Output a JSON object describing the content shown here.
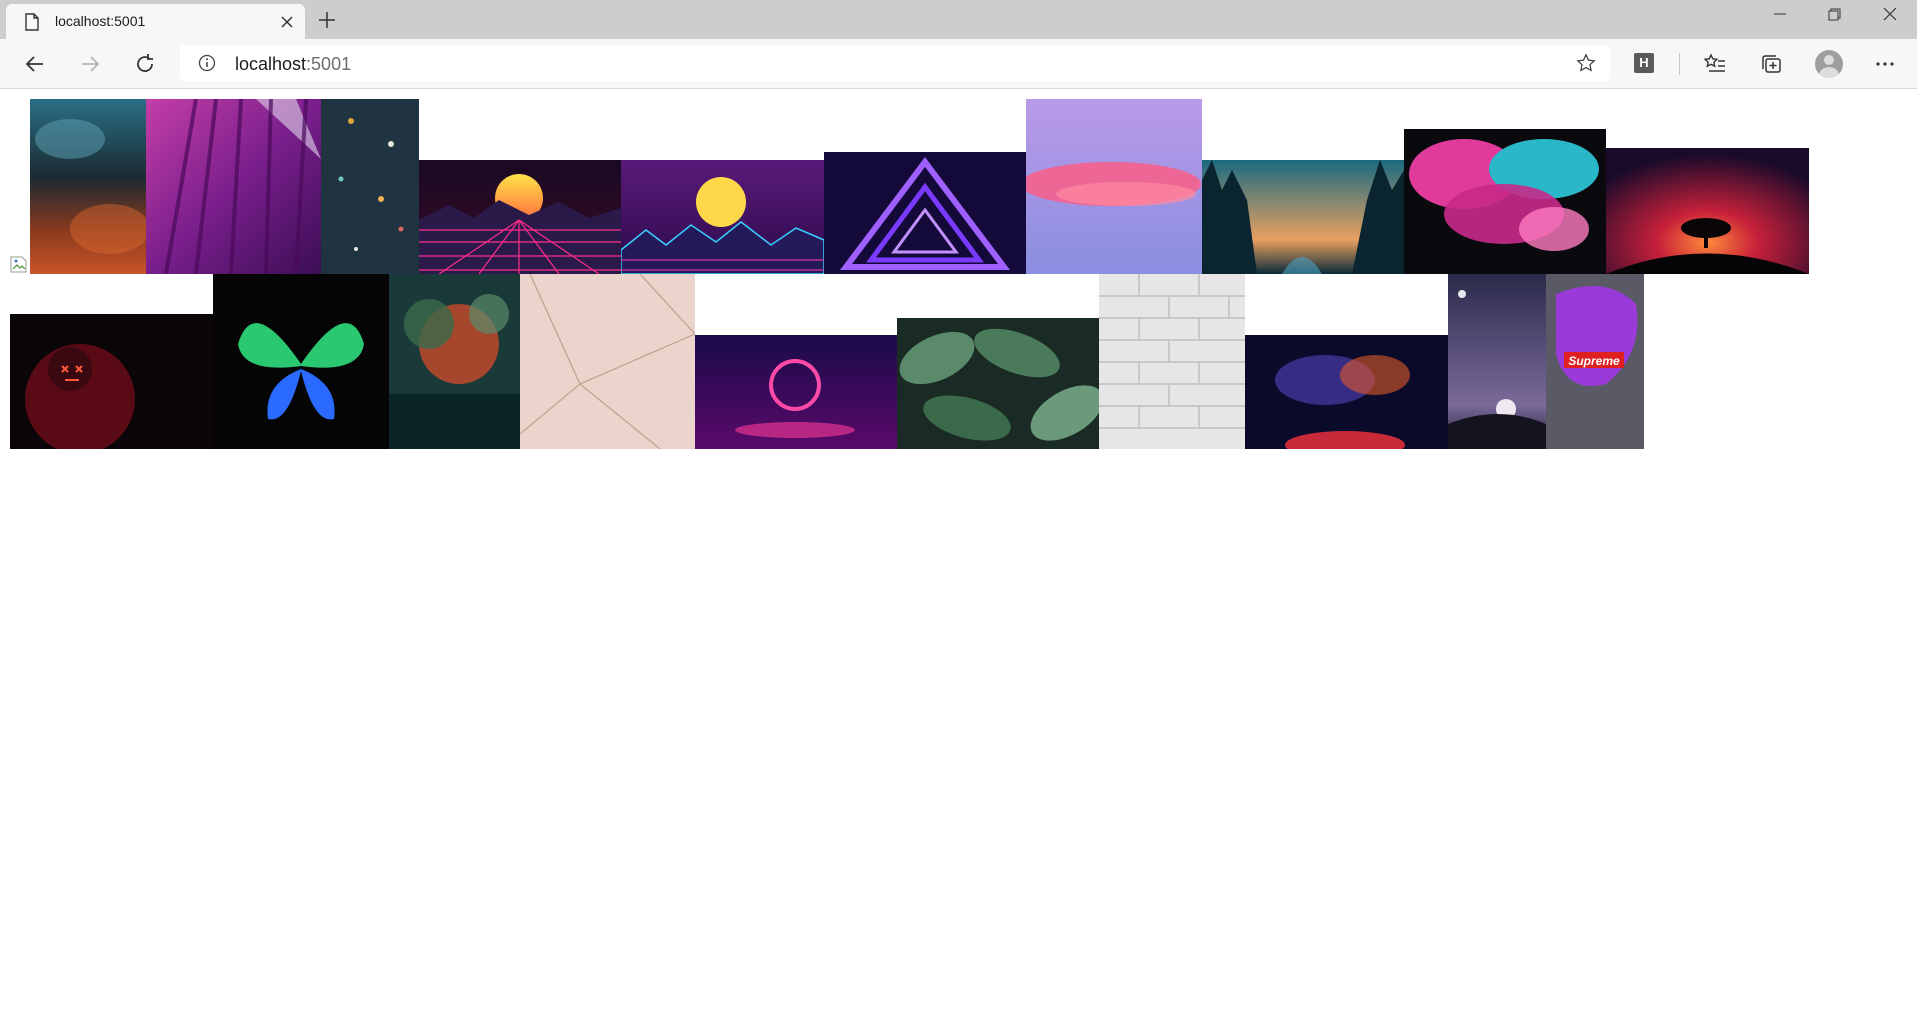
{
  "browser": {
    "tab": {
      "title": "localhost:5001",
      "icon": "page-icon"
    },
    "new_tab_icon": "plus-icon",
    "window_controls": [
      "minimize-icon",
      "restore-icon",
      "close-icon"
    ],
    "address": {
      "host": "localhost",
      "port": ":5001",
      "info_icon": "info-icon"
    },
    "nav_icons": [
      "back-arrow-icon",
      "forward-arrow-icon",
      "refresh-icon"
    ],
    "toolbar_icons": [
      "favorite-star-icon",
      "extension-h-icon",
      "favorites-icon",
      "collections-icon",
      "profile-avatar",
      "more-menu-icon"
    ],
    "extension_label": "H"
  },
  "gallery": {
    "rows": [
      {
        "items": [
          "smoke-teal-orange",
          "magenta-forest",
          "space-planets",
          "synthwave-sun-red",
          "synthwave-sun-blue",
          "neon-triangle",
          "pink-cloud-sky",
          "forest-river-sunset",
          "pink-teal-smoke",
          "red-tree-sunset"
        ]
      },
      {
        "items": [
          "hooded-neon-mask",
          "neon-butterfly",
          "bokeh-tree",
          "rose-gold-geometric",
          "neon-ring",
          "tropical-leaves",
          "white-brick-wall",
          "cosmic-universe",
          "night-moon-field",
          "supreme-purple"
        ]
      }
    ],
    "broken_image_icon": "broken-image-icon",
    "supreme_text": "Supreme"
  },
  "colors": {
    "tabstrip": "#cdcdcd",
    "toolbar": "#f7f7f7",
    "page": "#ffffff"
  }
}
